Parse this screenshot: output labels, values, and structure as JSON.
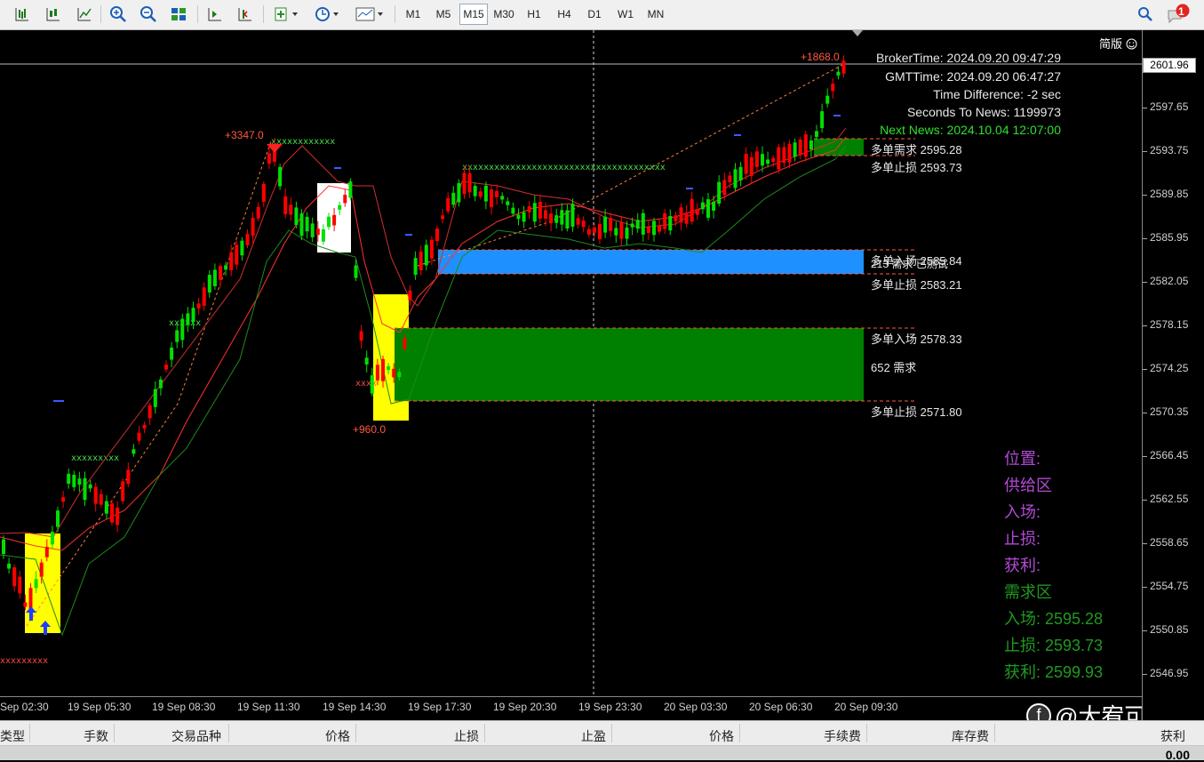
{
  "toolbar": {
    "timeframes": [
      "M1",
      "M5",
      "M15",
      "M30",
      "H1",
      "H4",
      "D1",
      "W1",
      "MN"
    ],
    "active_timeframe": "M15",
    "notification_count": "1"
  },
  "chart": {
    "mode_label": "简版",
    "current_price": "2601.96",
    "price_axis": [
      "2601.96",
      "2597.65",
      "2593.75",
      "2589.85",
      "2585.95",
      "2582.05",
      "2578.15",
      "2574.25",
      "2570.35",
      "2566.45",
      "2562.55",
      "2558.65",
      "2554.75",
      "2550.85",
      "2546.95"
    ],
    "time_axis": [
      "Sep 02:30",
      "19 Sep 05:30",
      "19 Sep 08:30",
      "19 Sep 11:30",
      "19 Sep 14:30",
      "19 Sep 17:30",
      "19 Sep 20:30",
      "19 Sep 23:30",
      "20 Sep 03:30",
      "20 Sep 06:30",
      "20 Sep 09:30"
    ],
    "info": {
      "broker_time": "BrokerTime: 2024.09.20 09:47:29",
      "gmt_time": "GMTTime: 2024.09.20 06:47:27",
      "time_difference": "Time Difference: -2 sec",
      "seconds_to_news": "Seconds To News: 1199973",
      "next_news": "Next News: 2024.10.04 12:07:00"
    },
    "peak_labels": {
      "top_right": "+1868.0",
      "top_mid": "+3347.0",
      "low_mid": "+960.0"
    },
    "zones": {
      "z1_title": "多单需求",
      "z1_entry": "2595.28",
      "z1_stop": "多单止损 2593.73",
      "z2_entry": "多单入场 2585.84",
      "z2_demand": "213 需求 已测试",
      "z2_stop": "多单止损 2583.21",
      "z3_entry": "多单入场 2578.33",
      "z3_demand": "652 需求",
      "z3_stop": "多单止损 2571.80"
    },
    "panel": {
      "position": "位置:",
      "supply": "供给区",
      "supply_entry": "入场:",
      "supply_stop": "止损:",
      "supply_tp": "获利:",
      "demand": "需求区",
      "demand_entry": "入场:  2595.28",
      "demand_stop": "止损:  2593.73",
      "demand_tp": "获利:  2599.93"
    },
    "watermark": "@大宥可为",
    "colors": {
      "bull": "#00e000",
      "bear": "#ff0000",
      "demand_green": "#008000",
      "tested_blue": "#1e90ff",
      "highlight_yellow": "#ffff00",
      "panel_purple": "#b44ad6",
      "panel_green": "#1f9a1f"
    }
  },
  "terminal": {
    "columns": [
      "类型",
      "手数",
      "交易品种",
      "价格",
      "止损",
      "止盈",
      "价格",
      "手续费",
      "库存费",
      "获利"
    ],
    "total": "0.00"
  }
}
